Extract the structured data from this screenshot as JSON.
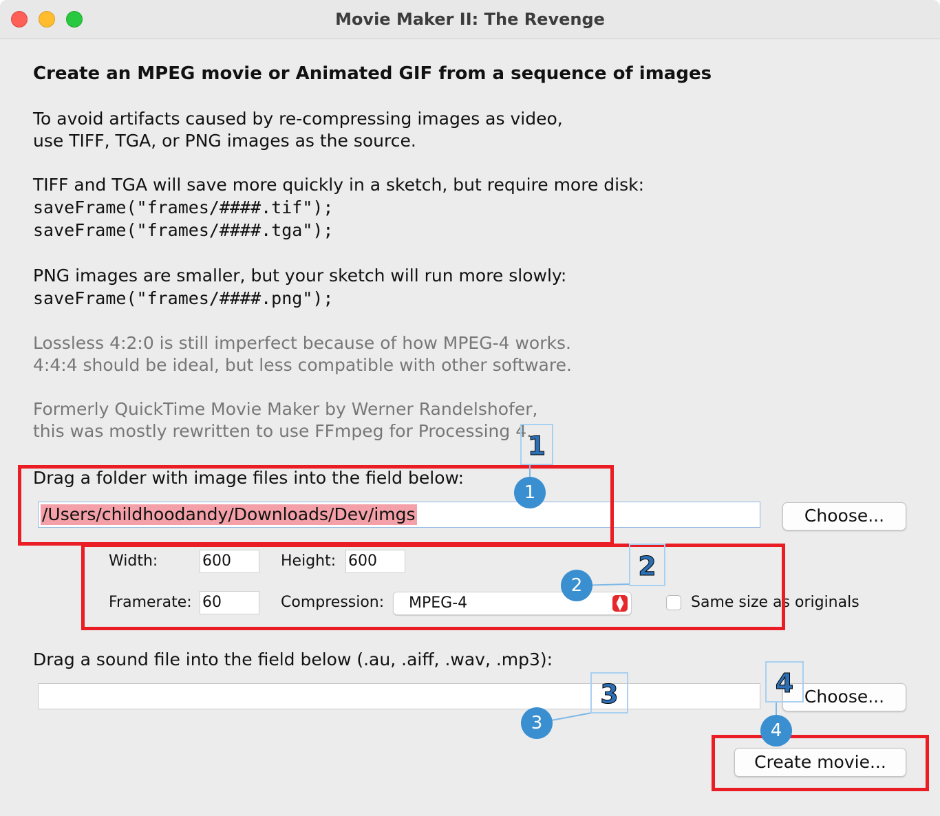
{
  "window": {
    "title": "Movie Maker II: The Revenge"
  },
  "intro": {
    "heading": "Create an MPEG movie or Animated GIF from a sequence of images",
    "para1_line1": "To avoid artifacts caused by re-compressing images as video,",
    "para1_line2": "use TIFF, TGA, or PNG images as the source.",
    "para2_line1": "TIFF and TGA will save more quickly in a sketch, but require more disk:",
    "code_tif": "saveFrame(\"frames/####.tif\");",
    "code_tga": "saveFrame(\"frames/####.tga\");",
    "para3_line1": "PNG images are smaller, but your sketch will run more slowly:",
    "code_png": "saveFrame(\"frames/####.png\");",
    "note1_line1": "Lossless 4:2:0 is still imperfect because of how MPEG-4 works.",
    "note1_line2": "4:4:4 should be ideal, but less compatible with other software.",
    "note2_line1": "Formerly QuickTime Movie Maker by Werner Randelshofer,",
    "note2_line2": "this was mostly rewritten to use FFmpeg for Processing 4."
  },
  "image_folder": {
    "label": "Drag a folder with image files into the field below:",
    "value": "/Users/childhoodandy/Downloads/Dev/imgs",
    "choose_label": "Choose..."
  },
  "settings": {
    "width_label": "Width:",
    "width_value": "600",
    "height_label": "Height:",
    "height_value": "600",
    "framerate_label": "Framerate:",
    "framerate_value": "60",
    "compression_label": "Compression:",
    "compression_value": "MPEG-4",
    "same_size_label": "Same size as originals",
    "same_size_checked": false
  },
  "sound": {
    "label": "Drag a sound file into the field below (.au, .aiff, .wav, .mp3):",
    "value": "",
    "choose_label": "Choose..."
  },
  "actions": {
    "create_label": "Create movie..."
  },
  "annotations": {
    "color_box": "#ea1c24",
    "color_marker": "#3a8fd0",
    "markers": [
      "1",
      "2",
      "3",
      "4"
    ]
  }
}
